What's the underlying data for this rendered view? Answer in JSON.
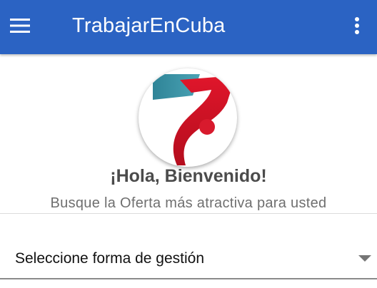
{
  "app_bar": {
    "title": "TrabajarEnCuba",
    "background_color": "#2b63c3",
    "menu_icon": "hamburger-menu-icon",
    "overflow_icon": "more-vertical-icon"
  },
  "logo": {
    "icon": "trabajarencuba-logo",
    "colors": {
      "teal": "#3a8fa3",
      "red": "#cf1225"
    }
  },
  "welcome": {
    "title": "¡Hola, Bienvenido!",
    "subtitle": "Busque la Oferta más atractiva para usted"
  },
  "management_select": {
    "selected_label": "Seleccione forma de gestión",
    "arrow_icon": "dropdown-arrow-icon"
  }
}
